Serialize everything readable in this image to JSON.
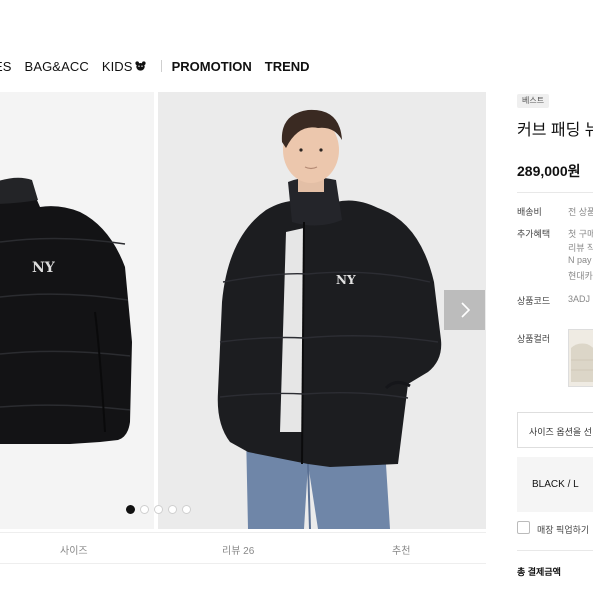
{
  "nav": {
    "items": [
      "ES",
      "BAG&ACC",
      "KIDS"
    ],
    "bold_items": [
      "PROMOTION",
      "TREND"
    ]
  },
  "gallery": {
    "slide_count": 5,
    "active_slide": 1,
    "next_icon": "chevron-right-icon"
  },
  "tabs": [
    "사이즈",
    "리뷰 26",
    "추천"
  ],
  "product": {
    "badge": "베스트",
    "title": "커브 패딩 뉴",
    "price": "289,000원",
    "shipping_label": "배송비",
    "shipping_value": "전 상품",
    "benefit_label": "추가혜택",
    "benefit_lines": [
      "첫 구매",
      "리뷰 작",
      "N pay",
      "현대카"
    ],
    "code_label": "상품코드",
    "code_value": "3ADJ",
    "color_label": "상품컬러",
    "size_select_placeholder": "사이즈 옵션을 선",
    "selected_option": "BLACK / L",
    "pickup_label": "매장 픽업하기",
    "total_label": "총 결제금액"
  },
  "colors": {
    "jacket": "#1c1d20",
    "jeans": "#6f86a8",
    "accent": "#111111"
  }
}
